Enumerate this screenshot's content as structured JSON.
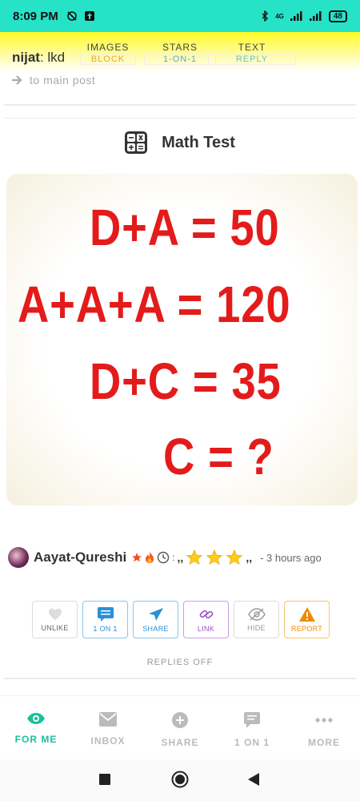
{
  "status": {
    "time": "8:09 PM",
    "network": "4G",
    "battery": "48"
  },
  "header": {
    "user_name": "nijat",
    "user_suffix": ": lkd",
    "tabs": [
      {
        "label": "IMAGES",
        "sub": "BLOCK",
        "sub_color": "#e8a33a"
      },
      {
        "label": "STARS",
        "sub": "1-ON-1",
        "sub_color": "#5aa9d6"
      },
      {
        "label": "TEXT",
        "sub": "REPLY",
        "sub_color": "#6cc3c9"
      }
    ]
  },
  "back_link": "to main post",
  "post": {
    "title": "Math Test",
    "puzzle_lines": [
      "D+A = 50",
      "A+A+A = 120",
      "D+C = 35",
      "C = ?"
    ],
    "author": "Aayat-Qureshi",
    "time_ago": "- 3 hours ago",
    "separator": ":",
    "quote_open": ",,",
    "quote_close": ",,"
  },
  "actions": [
    {
      "label": "UNLIKE",
      "icon": "heart-icon",
      "color": "#888888"
    },
    {
      "label": "1 ON 1",
      "icon": "chat-icon",
      "color": "#2a8fd6"
    },
    {
      "label": "SHARE",
      "icon": "send-icon",
      "color": "#2a8fd6"
    },
    {
      "label": "LINK",
      "icon": "link-icon",
      "color": "#9b4fc8"
    },
    {
      "label": "HIDE",
      "icon": "eye-off-icon",
      "color": "#999999"
    },
    {
      "label": "REPORT",
      "icon": "warning-icon",
      "color": "#f08a00"
    }
  ],
  "replies_status": "REPLIES OFF",
  "bottom_nav": [
    {
      "label": "FOR ME",
      "icon": "eye-icon",
      "color": "#1bbf9c"
    },
    {
      "label": "INBOX",
      "icon": "mail-icon",
      "color": "#bbbbbb"
    },
    {
      "label": "SHARE",
      "icon": "plus-circle-icon",
      "color": "#bbbbbb"
    },
    {
      "label": "1 ON 1",
      "icon": "chat-bubble-icon",
      "color": "#bbbbbb"
    },
    {
      "label": "MORE",
      "icon": "more-icon",
      "color": "#bbbbbb"
    }
  ],
  "colors": {
    "status_bar": "#26e3c8",
    "header_yellow": "#fffb22",
    "puzzle_red": "#e41b1b",
    "accent": "#1bbf9c"
  }
}
